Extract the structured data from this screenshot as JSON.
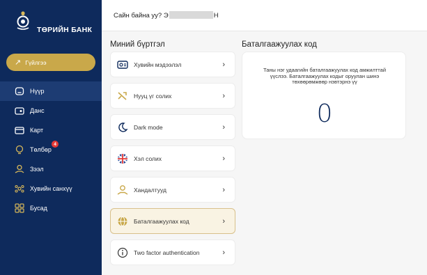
{
  "brand": {
    "name": "ТӨРИЙН БАНК"
  },
  "sidebar": {
    "pay_button": "Гүйлгээ",
    "items": [
      {
        "label": "Нүүр",
        "icon": "home-icon"
      },
      {
        "label": "Данс",
        "icon": "account-icon"
      },
      {
        "label": "Карт",
        "icon": "card-icon"
      },
      {
        "label": "Төлбөр",
        "icon": "payment-icon",
        "badge": "4"
      },
      {
        "label": "Зээл",
        "icon": "loan-icon"
      },
      {
        "label": "Хувийн санхүү",
        "icon": "finance-icon"
      },
      {
        "label": "Бусад",
        "icon": "grid-icon"
      }
    ]
  },
  "header": {
    "greeting_prefix": "Сайн байна уу? Э",
    "greeting_suffix": "Н"
  },
  "profile": {
    "title": "Миний бүртгэл",
    "items": [
      {
        "label": "Хувийн мэдээлэл",
        "icon": "id-card-icon"
      },
      {
        "label": "Нууц үг солих",
        "icon": "key-icon"
      },
      {
        "label": "Dark mode",
        "icon": "moon-icon"
      },
      {
        "label": "Хэл солих",
        "icon": "uk-flag-icon"
      },
      {
        "label": "Хандалтууд",
        "icon": "access-icon"
      },
      {
        "label": "Баталгаажуулах код",
        "icon": "globe-icon"
      },
      {
        "label": "Two factor authentication",
        "icon": "info-icon"
      }
    ]
  },
  "verification": {
    "title": "Баталгаажуулах код",
    "description": "Таны нэг удаагийн баталгаажуулах код амжилттай үүслээ. Баталгаажуулах кодыг оруулан шинэ төхөөрөмжөөр нэвтэрнэ үү",
    "code": "0"
  },
  "colors": {
    "sidebar": "#0e2a5c",
    "accent": "#c9a84a",
    "active_item": "#1d3c73",
    "badge": "#e53935"
  }
}
